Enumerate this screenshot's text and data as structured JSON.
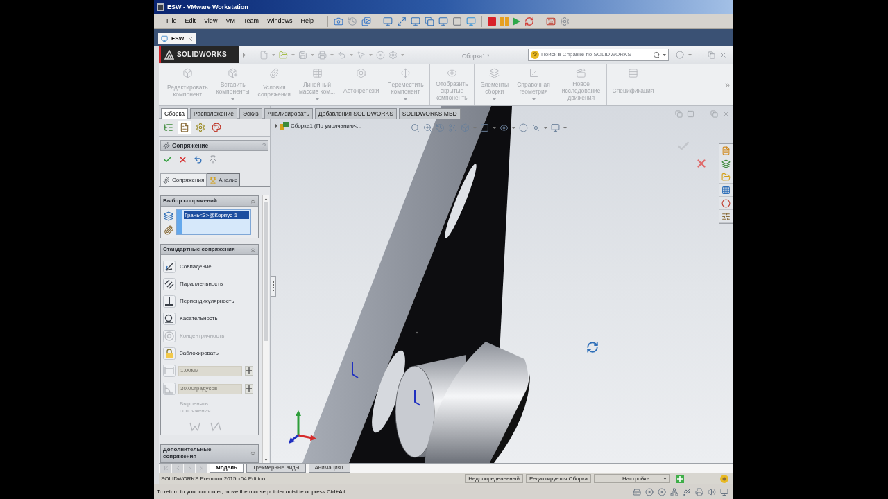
{
  "vm_window": {
    "title": "ESW - VMware Workstation",
    "menu": [
      "File",
      "Edit",
      "View",
      "VM",
      "Team",
      "Windows",
      "Help"
    ],
    "tabs": [
      {
        "label": "ESW",
        "selected": true
      }
    ]
  },
  "sw_titlebar": {
    "logo": "SOLIDWORKS",
    "document": "Сборка1 *",
    "search": {
      "placeholder": "Поиск в Справке по SOLIDWORKS"
    }
  },
  "command_manager": {
    "groups": [
      {
        "buttons": [
          {
            "lines": [
              "Редактировать",
              "компонент"
            ],
            "dropdown": false,
            "disabled": true
          },
          {
            "lines": [
              "Вставить",
              "компоненты"
            ],
            "dropdown": true,
            "disabled": true
          },
          {
            "lines": [
              "Условия",
              "сопряжения"
            ],
            "dropdown": false,
            "disabled": true
          },
          {
            "lines": [
              "Линейный",
              "массив ком..."
            ],
            "dropdown": true,
            "disabled": true
          },
          {
            "lines": [
              "Автокрепежи"
            ],
            "dropdown": false,
            "disabled": true
          },
          {
            "lines": [
              "Переместить",
              "компонент"
            ],
            "dropdown": true,
            "disabled": true
          }
        ]
      },
      {
        "buttons": [
          {
            "lines": [
              "Отобразить",
              "скрытые",
              "компоненты"
            ],
            "dropdown": false,
            "disabled": true
          }
        ]
      },
      {
        "buttons": [
          {
            "lines": [
              "Элементы",
              "сборки"
            ],
            "dropdown": true,
            "disabled": true
          },
          {
            "lines": [
              "Справочная",
              "геометрия"
            ],
            "dropdown": true,
            "disabled": true
          }
        ]
      },
      {
        "buttons": [
          {
            "lines": [
              "Новое",
              "исследование",
              "движения"
            ],
            "dropdown": false,
            "disabled": true
          }
        ]
      },
      {
        "buttons": [
          {
            "lines": [
              "Спецификация"
            ],
            "dropdown": false,
            "disabled": true
          }
        ]
      }
    ]
  },
  "ribbon_tabs": [
    {
      "label": "Сборка",
      "selected": true
    },
    {
      "label": "Расположение",
      "selected": false
    },
    {
      "label": "Эскиз",
      "selected": false
    },
    {
      "label": "Анализировать",
      "selected": false
    },
    {
      "label": "Добавления SOLIDWORKS",
      "selected": false
    },
    {
      "label": "SOLIDWORKS MBD",
      "selected": false
    }
  ],
  "property_manager": {
    "panel_tabs": [
      {
        "kind": "tree",
        "selected": false
      },
      {
        "kind": "properties",
        "selected": true
      },
      {
        "kind": "configurations",
        "selected": false
      },
      {
        "kind": "display",
        "selected": false
      }
    ],
    "title": "Сопряжение",
    "help": "?",
    "tabs": [
      {
        "label": "Сопряжения",
        "selected": true
      },
      {
        "label": "Анализ",
        "selected": false
      }
    ],
    "mate_selections": {
      "title": [
        "Выбор сопряжений"
      ],
      "expanded": true,
      "items": [
        {
          "label": "Грань<3>@Корпус-1",
          "selected": true
        }
      ]
    },
    "standard_mates": {
      "title": [
        "Стандартные сопряжения"
      ],
      "expanded": true,
      "items": [
        {
          "kind": "option",
          "label": "Совпадение",
          "disabled": false
        },
        {
          "kind": "option",
          "label": "Параллельность",
          "disabled": false
        },
        {
          "kind": "option",
          "label": "Перпендикулярность",
          "disabled": false
        },
        {
          "kind": "option",
          "label": "Касательность",
          "disabled": false
        },
        {
          "kind": "option",
          "label": "Концентричность",
          "disabled": true
        },
        {
          "kind": "option",
          "label": "Заблокировать",
          "disabled": false
        },
        {
          "kind": "field",
          "value": "1.00мм",
          "disabled": true
        },
        {
          "kind": "field",
          "value": "30.00градусов",
          "disabled": true
        },
        {
          "kind": "align",
          "lines": [
            "Выровнять",
            "сопряжения"
          ],
          "disabled": true
        }
      ]
    },
    "advanced_mates": {
      "title": [
        "Дополнительные",
        "сопряжения"
      ],
      "expanded": false
    }
  },
  "viewport": {
    "tree_flyout": "Сборка1 (По умолчанию<..."
  },
  "bottom_tabs": [
    {
      "label": "Модель",
      "selected": true
    },
    {
      "label": "Трехмерные виды",
      "selected": false
    },
    {
      "label": "Анимация1",
      "selected": false
    }
  ],
  "status_bar": {
    "product": "SOLIDWORKS Premium 2015 x64 Edition",
    "panes": [
      "Недоопределенный",
      "Редактируется Сборка"
    ],
    "units": "Настройка"
  },
  "vm_status": {
    "hint": "To return to your computer, move the mouse pointer outside or press Ctrl+Alt."
  }
}
